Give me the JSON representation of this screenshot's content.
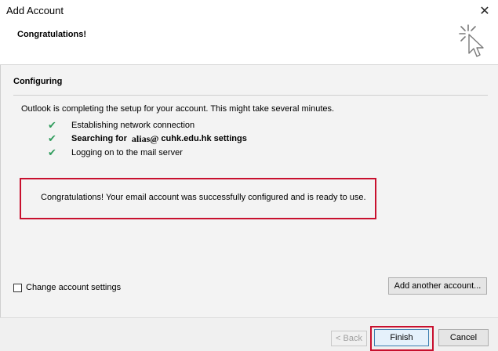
{
  "window": {
    "title": "Add Account",
    "close_glyph": "✕"
  },
  "header": {
    "title": "Congratulations!",
    "icon": "wizard-cursor-icon"
  },
  "section": {
    "title": "Configuring"
  },
  "intro_text": "Outlook is completing the setup for your account. This might take several minutes.",
  "steps": [
    {
      "check": "✔",
      "label": "Establishing network connection"
    },
    {
      "check": "✔",
      "prefix": "Searching for",
      "alias": "alias@",
      "suffix": "cuhk.edu.hk settings"
    },
    {
      "check": "✔",
      "label": "Logging on to the mail server"
    }
  ],
  "success_message": "Congratulations! Your email account was successfully configured and is ready to use.",
  "change_settings": {
    "label": "Change account settings",
    "checked": false
  },
  "buttons": {
    "add_another": "Add another account...",
    "back": "< Back",
    "finish": "Finish",
    "cancel": "Cancel"
  },
  "colors": {
    "highlight": "#c8102e",
    "check": "#2f9c5c"
  }
}
